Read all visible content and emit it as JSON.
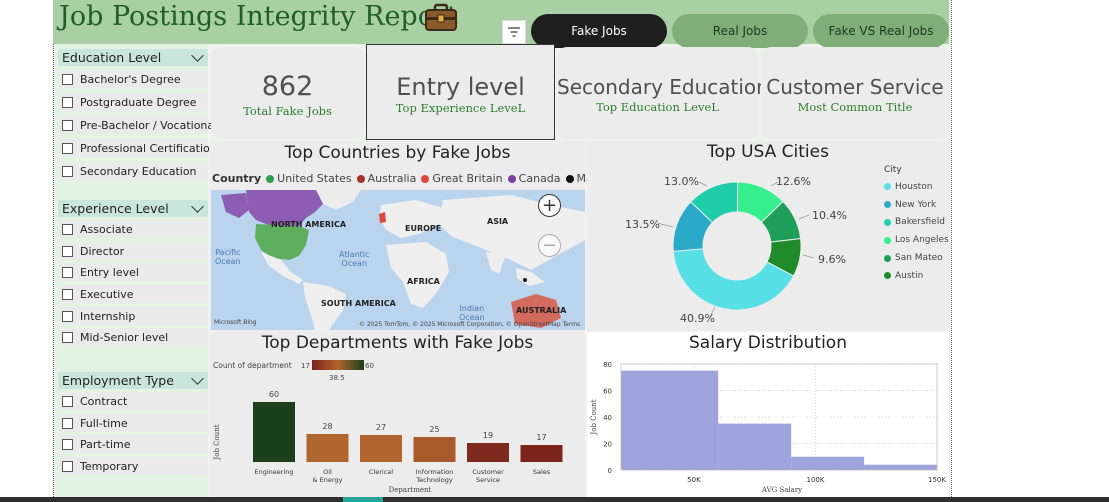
{
  "header": {
    "title": "Job Postings Integrity Report",
    "nav": [
      {
        "label": "Fake Jobs",
        "active": true
      },
      {
        "label": "Real Jobs",
        "active": false
      },
      {
        "label": "Fake VS Real Jobs",
        "active": false
      }
    ]
  },
  "filters": {
    "education": {
      "label": "Education Level",
      "options": [
        "Bachelor's Degree",
        "Postgraduate Degree",
        "Pre-Bachelor / Vocational",
        "Professional Certification",
        "Secondary Education"
      ]
    },
    "experience": {
      "label": "Experience Level",
      "options": [
        "Associate",
        "Director",
        "Entry level",
        "Executive",
        "Internship",
        "Mid-Senior level"
      ]
    },
    "employment": {
      "label": "Employment Type",
      "options": [
        "Contract",
        "Full-time",
        "Part-time",
        "Temporary"
      ]
    }
  },
  "kpis": [
    {
      "value": "862",
      "label": "Total Fake Jobs"
    },
    {
      "value": "Entry level",
      "label": "Top Experience LeveL"
    },
    {
      "value": "Secondary Education",
      "label": "Top Education LeveL"
    },
    {
      "value": "Customer Service",
      "label": "Most Common Title"
    }
  ],
  "map_panel": {
    "title": "Top Countries by Fake Jobs",
    "legend_title": "Country",
    "countries": [
      {
        "name": "United States",
        "color": "#2e9e4f"
      },
      {
        "name": "Australia",
        "color": "#a0322a"
      },
      {
        "name": "Great Britain",
        "color": "#e0463a"
      },
      {
        "name": "Canada",
        "color": "#7a3fa0"
      },
      {
        "name": "Malaysia",
        "color": "#111111"
      }
    ],
    "region_labels": [
      "NORTH AMERICA",
      "EUROPE",
      "ASIA",
      "AFRICA",
      "SOUTH AMERICA",
      "AUSTRALIA"
    ],
    "ocean_labels": {
      "pacific": "Pacific\nOcean",
      "atlantic": "Atlantic\nOcean",
      "indian": "Indian\nOcean"
    },
    "attribution_left": "Microsoft Bing",
    "attribution_right": "© 2025 TomTom, © 2025 Microsoft Corporation, © OpenStreetMap  Terms",
    "zoom_in": "+",
    "zoom_out": "−"
  },
  "cities_panel": {
    "title": "Top USA Cities",
    "legend_title": "City",
    "cities": [
      {
        "name": "Houston",
        "color": "#56e0e6"
      },
      {
        "name": "New York",
        "color": "#2aaac8"
      },
      {
        "name": "Bakersfield",
        "color": "#1fcda8"
      },
      {
        "name": "Los Angeles",
        "color": "#35ef8e"
      },
      {
        "name": "San Mateo",
        "color": "#1e9e58"
      },
      {
        "name": "Austin",
        "color": "#1e8a2a"
      }
    ],
    "labels": [
      "40.9%",
      "13.5%",
      "13.0%",
      "12.6%",
      "10.4%",
      "9.6%"
    ]
  },
  "departments_panel": {
    "title": "Top Departments with Fake Jobs",
    "scale_title": "Count of department",
    "scale_min": "17",
    "scale_mid": "38.5",
    "scale_max": "60",
    "ylabel": "Job Count",
    "xlabel": "Department"
  },
  "salary_panel": {
    "title": "Salary Distribution",
    "ylabel": "Job Count",
    "xlabel": "AVG Salary"
  },
  "chart_data": [
    {
      "type": "bar",
      "title": "Top Departments with Fake Jobs",
      "xlabel": "Department",
      "ylabel": "Job Count",
      "categories": [
        "Engineering",
        "Oil & Energy",
        "Clerical",
        "Information Technology",
        "Customer Service",
        "Sales"
      ],
      "values": [
        60,
        28,
        27,
        25,
        19,
        17
      ],
      "colors": [
        "#1b3f1b",
        "#b0652e",
        "#b0652e",
        "#a75a2c",
        "#7f2a1e",
        "#7a241c"
      ]
    },
    {
      "type": "pie",
      "title": "Top USA Cities",
      "categories": [
        "Houston",
        "New York",
        "Bakersfield",
        "Los Angeles",
        "San Mateo",
        "Austin"
      ],
      "values": [
        40.9,
        13.5,
        13.0,
        12.6,
        10.4,
        9.6
      ]
    },
    {
      "type": "bar",
      "title": "Salary Distribution",
      "xlabel": "AVG Salary",
      "ylabel": "Job Count",
      "bins": [
        {
          "from": 20000,
          "to": 60000,
          "count": 75
        },
        {
          "from": 60000,
          "to": 90000,
          "count": 35
        },
        {
          "from": 90000,
          "to": 120000,
          "count": 10
        },
        {
          "from": 120000,
          "to": 150000,
          "count": 4
        }
      ],
      "x_ticks": [
        "50K",
        "100K",
        "150K"
      ],
      "y_ticks": [
        "0",
        "20",
        "40",
        "60",
        "80"
      ],
      "ylim": [
        0,
        80
      ],
      "xlim": [
        20000,
        150000
      ],
      "color": "#9fa3dc"
    }
  ]
}
